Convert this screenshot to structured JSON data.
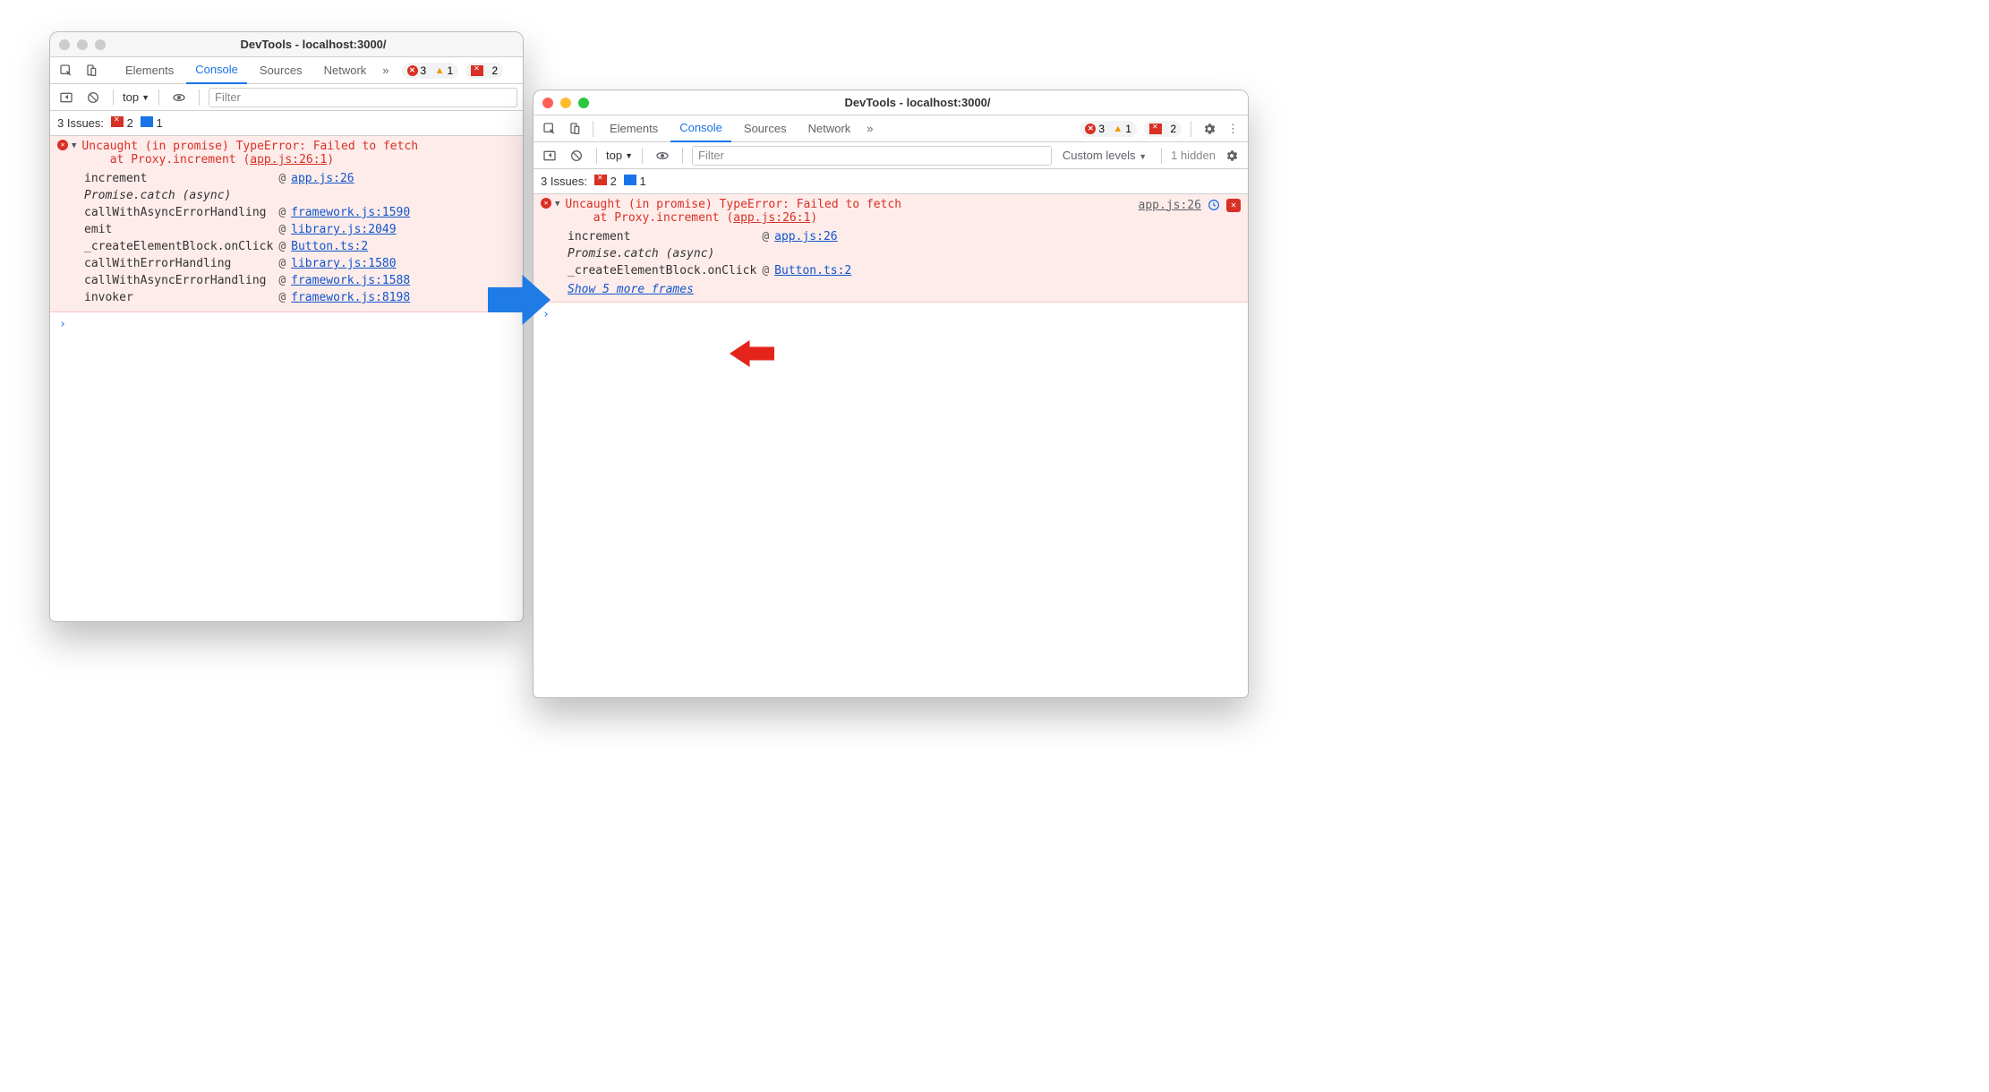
{
  "left": {
    "title": "DevTools - localhost:3000/",
    "tabs": [
      "Elements",
      "Console",
      "Sources",
      "Network"
    ],
    "badges": {
      "errors": "3",
      "warnings": "1",
      "flags": "2"
    },
    "toolbar": {
      "scope": "top",
      "filter_placeholder": "Filter"
    },
    "issues": {
      "label": "3 Issues:",
      "flags": "2",
      "msgs": "1"
    },
    "error_heading": "Uncaught (in promise) TypeError: Failed to fetch",
    "error_at_prefix": "at Proxy.increment (",
    "error_at_link": "app.js:26:1",
    "error_at_suffix": ")",
    "stack": [
      {
        "fn": "increment",
        "at": "@",
        "link": "app.js:26"
      },
      {
        "fn": "Promise.catch (async)",
        "ital": true
      },
      {
        "fn": "callWithAsyncErrorHandling",
        "at": "@",
        "link": "framework.js:1590"
      },
      {
        "fn": "emit",
        "at": "@",
        "link": "library.js:2049"
      },
      {
        "fn": "_createElementBlock.onClick",
        "at": "@",
        "link": "Button.ts:2"
      },
      {
        "fn": "callWithErrorHandling",
        "at": "@",
        "link": "library.js:1580"
      },
      {
        "fn": "callWithAsyncErrorHandling",
        "at": "@",
        "link": "framework.js:1588"
      },
      {
        "fn": "invoker",
        "at": "@",
        "link": "framework.js:8198"
      }
    ]
  },
  "right": {
    "title": "DevTools - localhost:3000/",
    "tabs": [
      "Elements",
      "Console",
      "Sources",
      "Network"
    ],
    "badges": {
      "errors": "3",
      "warnings": "1",
      "flags": "2"
    },
    "toolbar": {
      "scope": "top",
      "filter_placeholder": "Filter",
      "levels": "Custom levels",
      "hidden": "1 hidden"
    },
    "issues": {
      "label": "3 Issues:",
      "flags": "2",
      "msgs": "1"
    },
    "error_heading": "Uncaught (in promise) TypeError: Failed to fetch",
    "error_at_prefix": "at Proxy.increment (",
    "error_at_link": "app.js:26:1",
    "error_at_suffix": ")",
    "right_link": "app.js:26",
    "stack": [
      {
        "fn": "increment",
        "at": "@",
        "link": "app.js:26"
      },
      {
        "fn": "Promise.catch (async)",
        "ital": true
      },
      {
        "fn": "_createElementBlock.onClick",
        "at": "@",
        "link": "Button.ts:2"
      }
    ],
    "show_more": "Show 5 more frames"
  }
}
